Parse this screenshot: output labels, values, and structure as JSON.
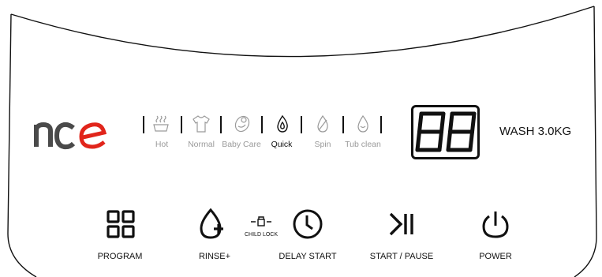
{
  "brand": {
    "logo_text": "nce",
    "logo_accent_color": "#e1251b",
    "logo_color": "#4a4a4a"
  },
  "programs": [
    {
      "id": "hot",
      "label": "Hot",
      "icon": "hot-water-icon",
      "active": false
    },
    {
      "id": "normal",
      "label": "Normal",
      "icon": "shirt-icon",
      "active": false
    },
    {
      "id": "baby_care",
      "label": "Baby Care",
      "icon": "baby-care-icon",
      "active": false
    },
    {
      "id": "quick",
      "label": "Quick",
      "icon": "flame-drop-icon",
      "active": true
    },
    {
      "id": "spin",
      "label": "Spin",
      "icon": "spin-drop-icon",
      "active": false
    },
    {
      "id": "tub_clean",
      "label": "Tub clean",
      "icon": "tub-clean-drop-icon",
      "active": false
    }
  ],
  "display": {
    "value": "88"
  },
  "capacity": {
    "label": "WASH 3.0KG"
  },
  "buttons": {
    "program": {
      "label": "PROGRAM",
      "icon": "grid-icon"
    },
    "rinse": {
      "label": "RINSE+",
      "icon": "drop-plus-icon"
    },
    "child_lock": {
      "label": "CHILD LOCK",
      "icon": "lock-icon"
    },
    "delay_start": {
      "label": "DELAY START",
      "icon": "clock-icon"
    },
    "start_pause": {
      "label": "START / PAUSE",
      "icon": "play-pause-icon"
    },
    "power": {
      "label": "POWER",
      "icon": "power-icon"
    }
  },
  "colors": {
    "inactive": "#9a9a9a",
    "active": "#111111"
  }
}
